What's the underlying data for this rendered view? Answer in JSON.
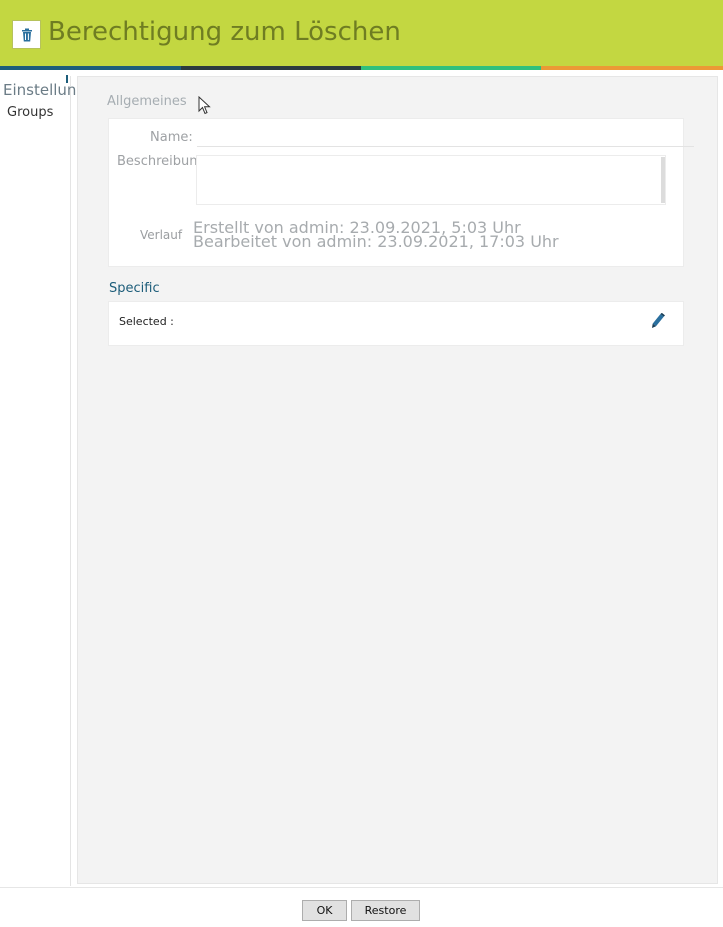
{
  "window": {
    "title": "Berechtigung zum Löschen",
    "icon": "trash-icon"
  },
  "colors": {
    "titlebar": "#c3d741",
    "title_text": "#6f7d22",
    "stripes": [
      "#1d5d7a",
      "#2b3a3e",
      "#2fc07c",
      "#eb9a35"
    ],
    "accent": "#1d5d7a"
  },
  "sidebar": {
    "title": "Einstellungen",
    "items": [
      {
        "label": "Groups"
      }
    ]
  },
  "general": {
    "section_label": "Allgemeines",
    "name_label": "Name:",
    "name_value": "",
    "description_label": "Beschreibung:",
    "description_value": "",
    "history_label": "Verlauf",
    "history": [
      "Erstellt von admin: 23.09.2021, 5:03 Uhr",
      "Bearbeitet von admin: 23.09.2021, 17:03 Uhr"
    ]
  },
  "specific": {
    "section_label": "Specific",
    "selected_label": "Selected :",
    "edit_icon": "pencil-icon"
  },
  "footer": {
    "ok_label": "OK",
    "restore_label": "Restore"
  }
}
